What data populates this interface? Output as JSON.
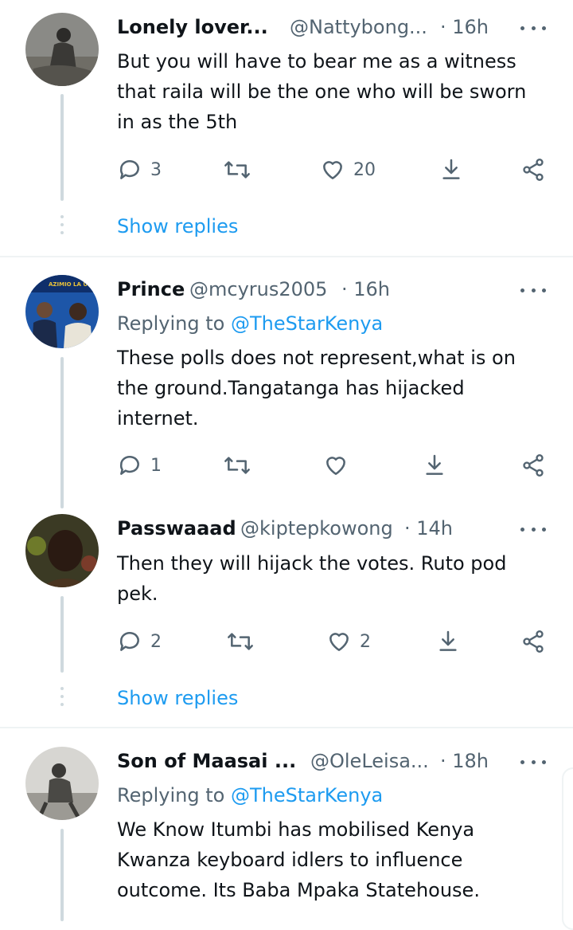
{
  "tweets": [
    {
      "name": "Lonely lover...",
      "handle": "@Nattybong...",
      "time": "· 16h",
      "replying_prefix": "",
      "replying_handle": "",
      "text_lines": [
        "But you will have to bear me as a witness",
        "that raila will be the one who will be sworn",
        "in as the 5th"
      ],
      "replies": "3",
      "retweets": "",
      "likes": "20",
      "show_replies": "Show replies"
    },
    {
      "name": "Prince",
      "handle": "@mcyrus2005",
      "time": "· 16h",
      "replying_prefix": "Replying to",
      "replying_handle": "@TheStarKenya",
      "avatar_text": "AZIMIO LA UMO",
      "text_lines": [
        "These polls does not represent,what is on",
        "the ground.Tangatanga has hijacked",
        "internet."
      ],
      "replies": "1",
      "retweets": "",
      "likes": ""
    },
    {
      "name": "Passwaaad",
      "handle": "@kiptepkowong",
      "time": "· 14h",
      "text_lines": [
        "Then they will hijack the votes. Ruto pod",
        "pek."
      ],
      "replies": "2",
      "retweets": "",
      "likes": "2",
      "show_replies": "Show replies"
    },
    {
      "name": "Son of Maasai ...",
      "handle": "@OleLeisa...",
      "time": "· 18h",
      "replying_prefix": "Replying to",
      "replying_handle": "@TheStarKenya",
      "text_lines": [
        "We Know Itumbi has mobilised Kenya",
        "Kwanza keyboard idlers  to influence",
        "outcome. Its Baba Mpaka Statehouse."
      ]
    }
  ],
  "colors": {
    "link": "#1d9bf0",
    "secondary": "#536471",
    "thread_line": "#cfd9de",
    "separator": "#eff3f4"
  },
  "icons": [
    "reply-icon",
    "retweet-icon",
    "like-icon",
    "share-icon",
    "send-icon",
    "more-icon"
  ]
}
